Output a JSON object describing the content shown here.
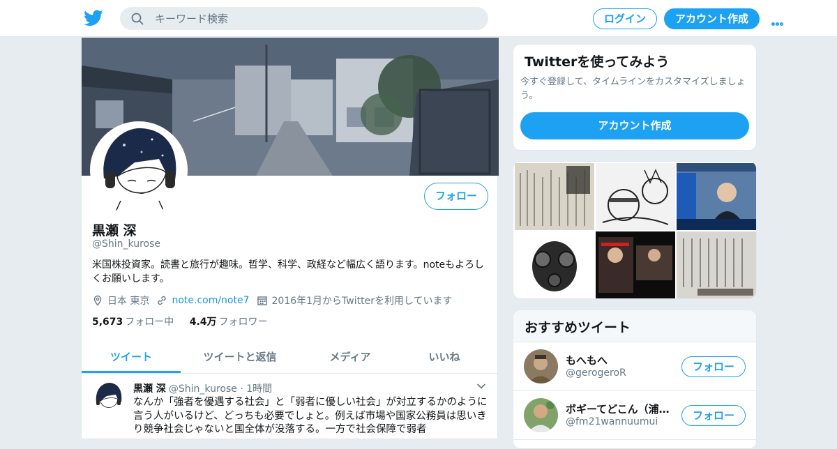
{
  "colors": {
    "accent": "#1da1f2",
    "link": "#1b95e0",
    "muted": "#657786",
    "background": "#e6ecf0"
  },
  "topbar": {
    "logo_icon": "twitter-bird-icon",
    "search_placeholder": "キーワード検索",
    "login_label": "ログイン",
    "signup_label": "アカウント作成",
    "more_icon": "more-dots-icon"
  },
  "profile": {
    "follow_label": "フォロー",
    "name": "黒瀬 深",
    "handle": "@Shin_kurose",
    "bio": "米国株投資家。読書と旅行が趣味。哲学、科学、政経など幅広く語ります。noteもよろしくお願いします。",
    "location": "日本 東京",
    "url": "note.com/note7",
    "joined": "2016年1月からTwitterを利用しています",
    "following_count": "5,673",
    "following_label": "フォロー中",
    "followers_count": "4.4万",
    "followers_label": "フォロワー"
  },
  "tabs": [
    {
      "label": "ツイート",
      "active": true
    },
    {
      "label": "ツイートと返信",
      "active": false
    },
    {
      "label": "メディア",
      "active": false
    },
    {
      "label": "いいね",
      "active": false
    }
  ],
  "tweet": {
    "name": "黒瀬 深",
    "handle": "@Shin_kurose",
    "separator": "·",
    "time": "1時間",
    "text": "なんか「強者を優遇する社会」と「弱者に優しい社会」が対立するかのように言う人がいるけど、どっちも必要でしょと。例えば市場や国家公務員は思いきり競争社会じゃないと国全体が没落する。一方で社会保障で弱者"
  },
  "try_card": {
    "title": "Twitterを使ってみよう",
    "description": "今すぐ登録して、タイムラインをカスタマイズしましょう。",
    "button_label": "アカウント作成"
  },
  "recommended": {
    "title": "おすすめツイート",
    "users": [
      {
        "name": "もへもへ",
        "handle": "@gerogeroR",
        "follow_label": "フォロー"
      },
      {
        "name": "ボギーてどこん（浦...",
        "handle": "@fm21wannuumui",
        "follow_label": "フォロー"
      }
    ]
  }
}
